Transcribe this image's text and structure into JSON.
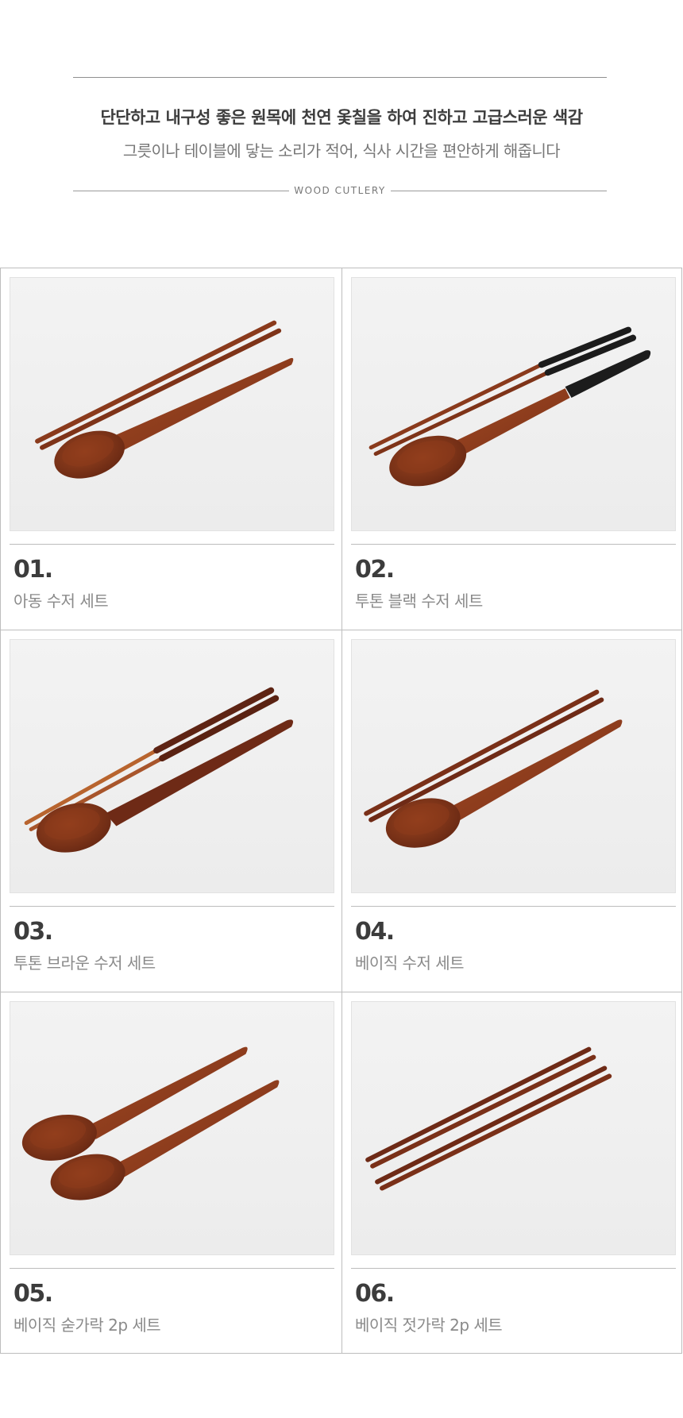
{
  "header": {
    "headline": "단단하고 내구성 좋은 원목에 천연 옻칠을 하여 진하고 고급스러운 색감",
    "subline": "그릇이나 테이블에 닿는 소리가 적어, 식사 시간을 편안하게 해줍니다",
    "divider_label": "WOOD CUTLERY"
  },
  "colors": {
    "wood": "#8a3a1c",
    "wood_light": "#a8552b",
    "wood_dark": "#5e2414",
    "lacquer_black": "#1c1c1c"
  },
  "products": [
    {
      "number": "01.",
      "name": "아동 수저 세트",
      "image": "spoon-chopsticks-short-icon"
    },
    {
      "number": "02.",
      "name": "투톤 블랙 수저 세트",
      "image": "spoon-chopsticks-black-icon"
    },
    {
      "number": "03.",
      "name": "투톤 브라운 수저 세트",
      "image": "spoon-chopsticks-brown-icon"
    },
    {
      "number": "04.",
      "name": "베이직 수저 세트",
      "image": "spoon-chopsticks-icon"
    },
    {
      "number": "05.",
      "name": "베이직 숟가락 2p 세트",
      "image": "two-spoons-icon"
    },
    {
      "number": "06.",
      "name": "베이직 젓가락 2p 세트",
      "image": "two-chopsticks-icon"
    }
  ]
}
